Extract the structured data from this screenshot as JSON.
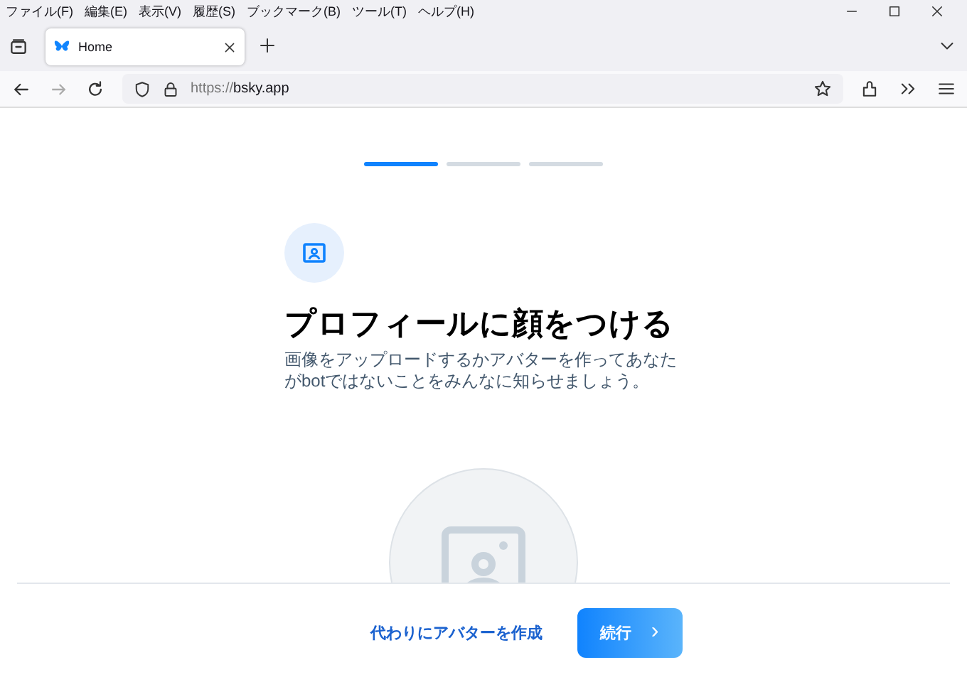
{
  "menu": [
    "ファイル(F)",
    "編集(E)",
    "表示(V)",
    "履歴(S)",
    "ブックマーク(B)",
    "ツール(T)",
    "ヘルプ(H)"
  ],
  "tabs": [
    {
      "label": "Home",
      "selected": true
    }
  ],
  "address": {
    "scheme": "https://",
    "host": "bsky.app"
  },
  "steps": [
    {
      "selected": true
    },
    {
      "selected": false
    },
    {
      "selected": false
    }
  ],
  "title": "プロフィールに顔をつける",
  "description": "画像をアップロードするかアバターを作ってあなたがbotではないことをみんなに知らせましょう。",
  "footer": {
    "link": "代わりにアバターを作成",
    "button": "続行",
    "button_icon": "›"
  }
}
